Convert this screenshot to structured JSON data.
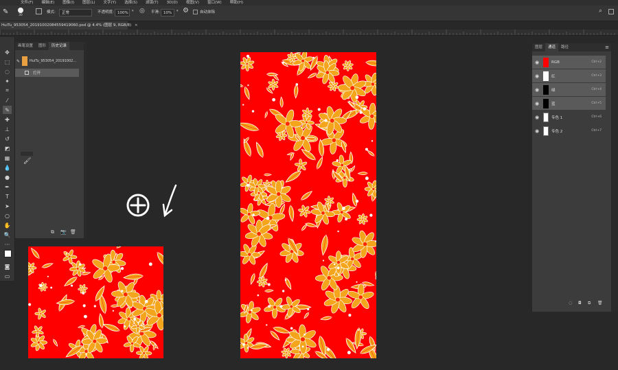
{
  "menu": [
    "文件(F)",
    "编辑(E)",
    "图像(I)",
    "图层(L)",
    "文字(Y)",
    "选择(S)",
    "滤镜(T)",
    "3D(D)",
    "视图(V)",
    "窗口(W)",
    "帮助(H)"
  ],
  "options": {
    "brush_size": "30",
    "mode_label": "模式:",
    "mode_value": "正常",
    "opacity_label": "不透明度:",
    "opacity_value": "100%",
    "smoothing_label": "平滑:",
    "smoothing_value": "10%",
    "auto_erase_label": "自动抹除"
  },
  "document_tab": "HuiTu_953054_20191002084559419060.psd @ 4.4% (图层 9, RGB/8)",
  "history_panel": {
    "tabs": [
      "画笔设置",
      "图形",
      "历史记录"
    ],
    "active_tab": 2,
    "snapshot_name": "HuiTu_953054_20191002...",
    "steps": [
      "打开"
    ]
  },
  "channels_panel": {
    "tabs": [
      "图层",
      "通道",
      "路径"
    ],
    "active_tab": 1,
    "channels": [
      {
        "name": "RGB",
        "shortcut": "Ctrl+2",
        "thumb_color": "#ff0000"
      },
      {
        "name": "红",
        "shortcut": "Ctrl+3",
        "thumb_color": "#ffffff"
      },
      {
        "name": "绿",
        "shortcut": "Ctrl+4",
        "thumb_color": "#000000"
      },
      {
        "name": "蓝",
        "shortcut": "Ctrl+5",
        "thumb_color": "#000000"
      },
      {
        "name": "专色 1",
        "shortcut": "Ctrl+6",
        "thumb_color": "#ffffff"
      },
      {
        "name": "专色 2",
        "shortcut": "Ctrl+7",
        "thumb_color": "#ffffff"
      }
    ]
  },
  "colors": {
    "canvas_red": "#ff0000",
    "flower_orange": "#f5a51c",
    "foreground": "#ffffff",
    "background": "#f0b020"
  },
  "icons": [
    "brush-icon",
    "eye-icon",
    "plus-circle-icon",
    "arrow-down-left-icon",
    "trash-icon",
    "camera-icon",
    "new-icon"
  ]
}
